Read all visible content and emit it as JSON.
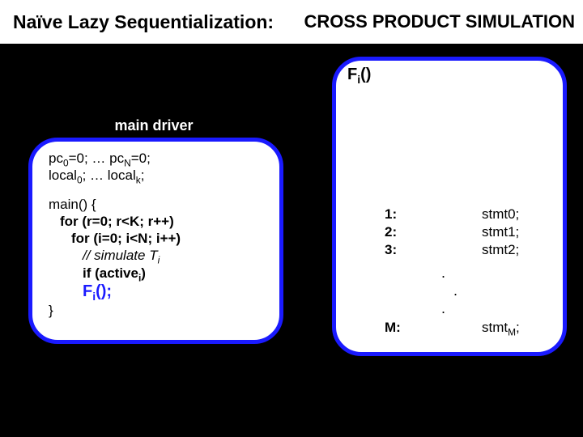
{
  "title": {
    "left": "Naïve Lazy Sequentialization:",
    "right": "CROSS PRODUCT SIMULATION"
  },
  "driver": {
    "label": "main driver",
    "init_pc_html": "pc<sub>0</sub>=0;  … pc<sub>N</sub>=0;",
    "init_local_html": "local<sub>0</sub>; … local<sub>k</sub>;",
    "main_open": "main() {",
    "for_r": "for (r=0; r<K; r++)",
    "for_i": "for (i=0; i<N; i++)",
    "simulate_html": "// simulate T<sub>i</sub>",
    "if_active_html": "if (active<sub>i</sub>)",
    "call_html": "F<sub>i</sub>();",
    "main_close": "}"
  },
  "fi": {
    "title_html": "F<sub>i</sub>()",
    "labels": [
      "1:",
      "2:",
      "3:"
    ],
    "stmts": [
      "stmt0;",
      "stmt1;",
      "stmt2;"
    ],
    "ellipsis1": ".",
    "ellipsis2": ".",
    "ellipsis3": ".",
    "m_label": "M:",
    "m_stmt_html": "stmt<sub>M</sub>;"
  }
}
